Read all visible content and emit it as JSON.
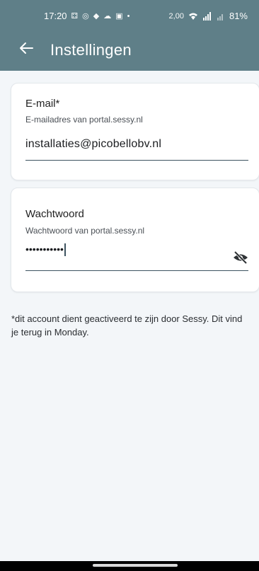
{
  "status_bar": {
    "time": "17:20",
    "left_icons": [
      "⚃",
      "◎",
      "◆",
      "☁",
      "▣",
      "•"
    ],
    "speed": "2,00",
    "right_icons": [
      "wifi-icon",
      "signal-icon",
      "signal-icon"
    ],
    "battery": "81%"
  },
  "app_bar": {
    "title": "Instellingen",
    "back_icon": "arrow-back-icon"
  },
  "email": {
    "label": "E-mail*",
    "hint": "E-mailadres van portal.sessy.nl",
    "value": "installaties@picobellobv.nl"
  },
  "password": {
    "label": "Wachtwoord",
    "hint": "Wachtwoord van portal.sessy.nl",
    "value": "•••••••••••",
    "visibility_icon": "visibility-off-icon"
  },
  "note": "*dit account dient geactiveerd te zijn door Sessy. Dit vind je terug in Monday.",
  "colors": {
    "primary": "#5f7f88",
    "background": "#f3f6f9",
    "card": "#ffffff",
    "underline": "#3d5360"
  }
}
